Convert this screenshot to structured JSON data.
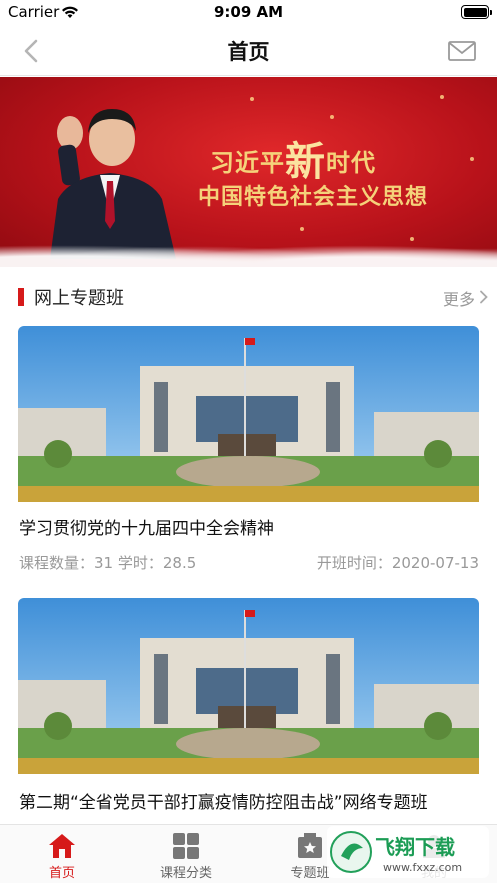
{
  "status_bar": {
    "carrier": "Carrier",
    "time": "9:09 AM"
  },
  "nav": {
    "title": "首页"
  },
  "banner": {
    "line1_pre": "习近平",
    "line1_big": "新",
    "line1_post": "时代",
    "line2": "中国特色社会主义思想"
  },
  "section": {
    "title": "网上专题班",
    "more": "更多"
  },
  "courses": [
    {
      "title": "学习贯彻党的十九届四中全会精神",
      "meta_left": "课程数量：31 学时：28.5",
      "meta_right": "开班时间：2020-07-13"
    },
    {
      "title": "第二期“全省党员干部打赢疫情防控阻击战”网络专题班"
    }
  ],
  "tabs": [
    {
      "label": "首页",
      "icon": "home-icon",
      "active": true
    },
    {
      "label": "课程分类",
      "icon": "grid-icon",
      "active": false
    },
    {
      "label": "专题班",
      "icon": "star-board-icon",
      "active": false
    },
    {
      "label": "我的",
      "icon": "user-icon",
      "active": false
    }
  ],
  "watermark": {
    "text": "飞翔下载",
    "url": "www.fxxz.com"
  },
  "colors": {
    "accent": "#d61a1a",
    "banner_red": "#c41820",
    "banner_gold": "#f5d27a"
  }
}
